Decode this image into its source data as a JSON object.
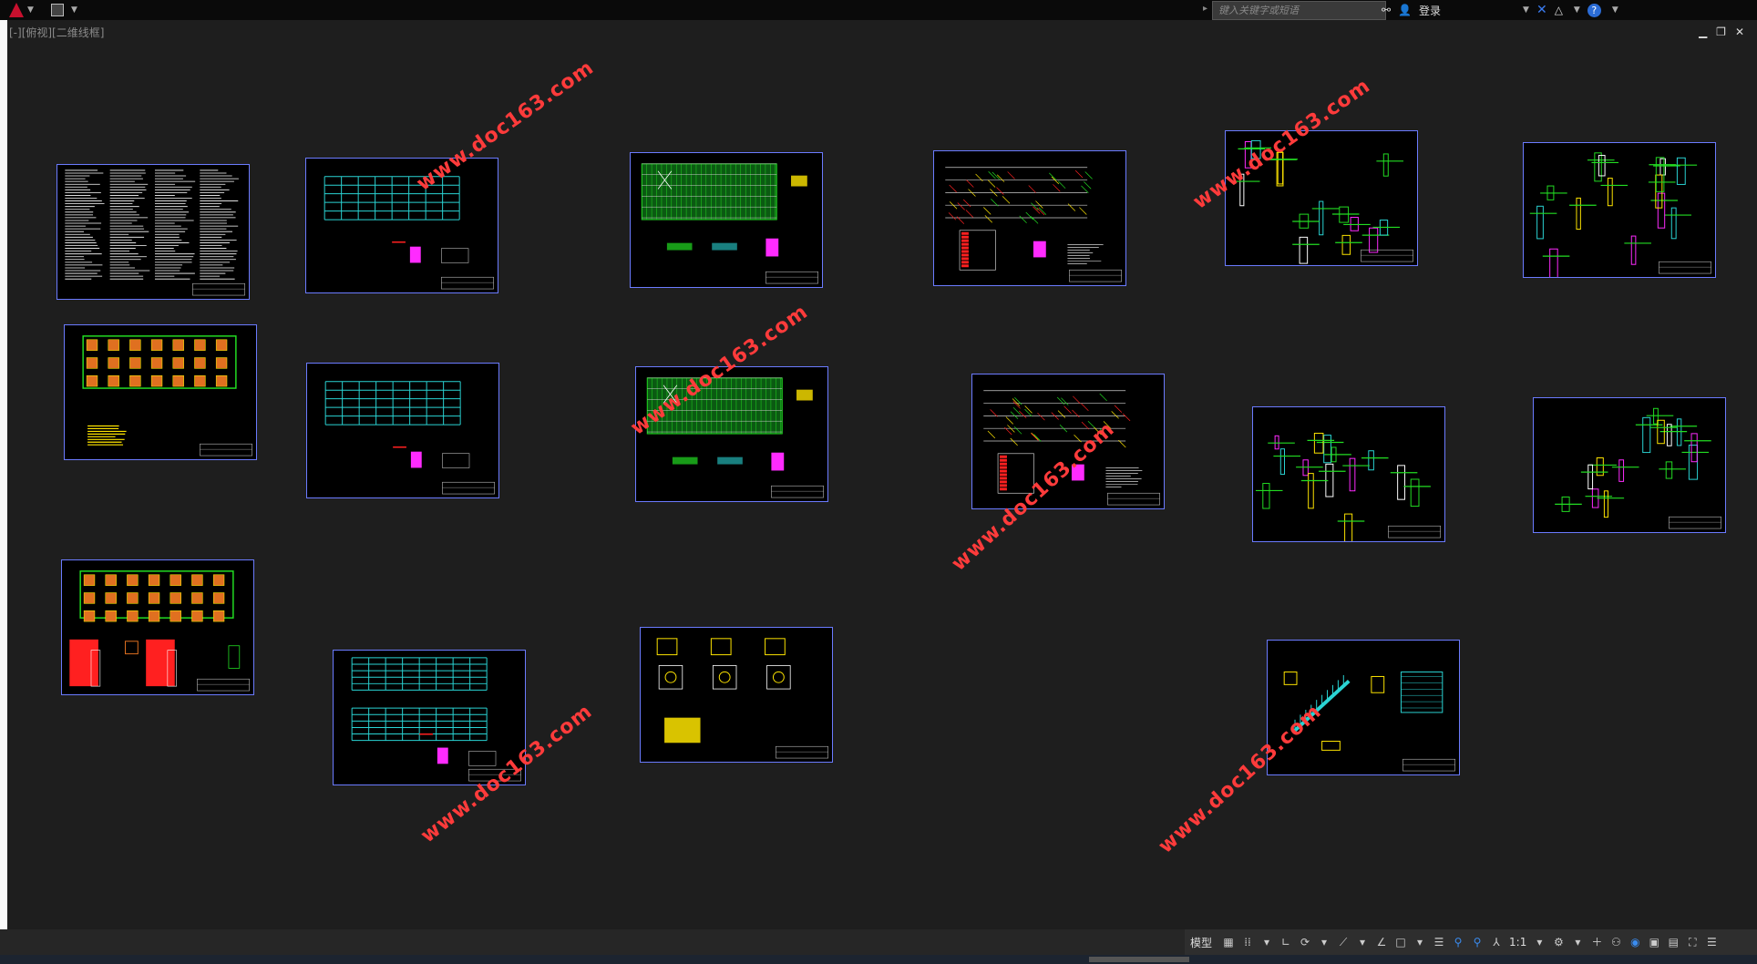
{
  "titlebar": {
    "search_placeholder": "键入关键字或短语",
    "signin_label": "登录",
    "help_label": "?"
  },
  "document": {
    "viewport_label": "[-][俯视][二维线框]"
  },
  "statusbar": {
    "model_label": "模型",
    "scale_label": "1:1"
  },
  "watermark_text": "www.doc163.com",
  "colors": {
    "sheet_border": "#6b7bff",
    "sheet_bg": "#000000",
    "canvas_bg": "#1e1e1e",
    "watermark": "#ff3b3b",
    "cyan": "#2ad4d4",
    "green": "#22dd22",
    "magenta": "#ff2bff",
    "yellow": "#ffe500",
    "red": "#ff2020"
  },
  "icons": [
    "app-logo-icon",
    "save-icon",
    "search-arrow-icon",
    "binoculars-icon",
    "user-icon",
    "exchange-icon",
    "a360-icon",
    "help-icon",
    "minimize-icon",
    "restore-icon",
    "close-icon",
    "grid-icon",
    "snap-icon",
    "ortho-icon",
    "polar-icon",
    "osnap-icon",
    "annotation-icon",
    "workspace-icon",
    "gear-icon",
    "plus-icon",
    "fullscreen-icon"
  ]
}
